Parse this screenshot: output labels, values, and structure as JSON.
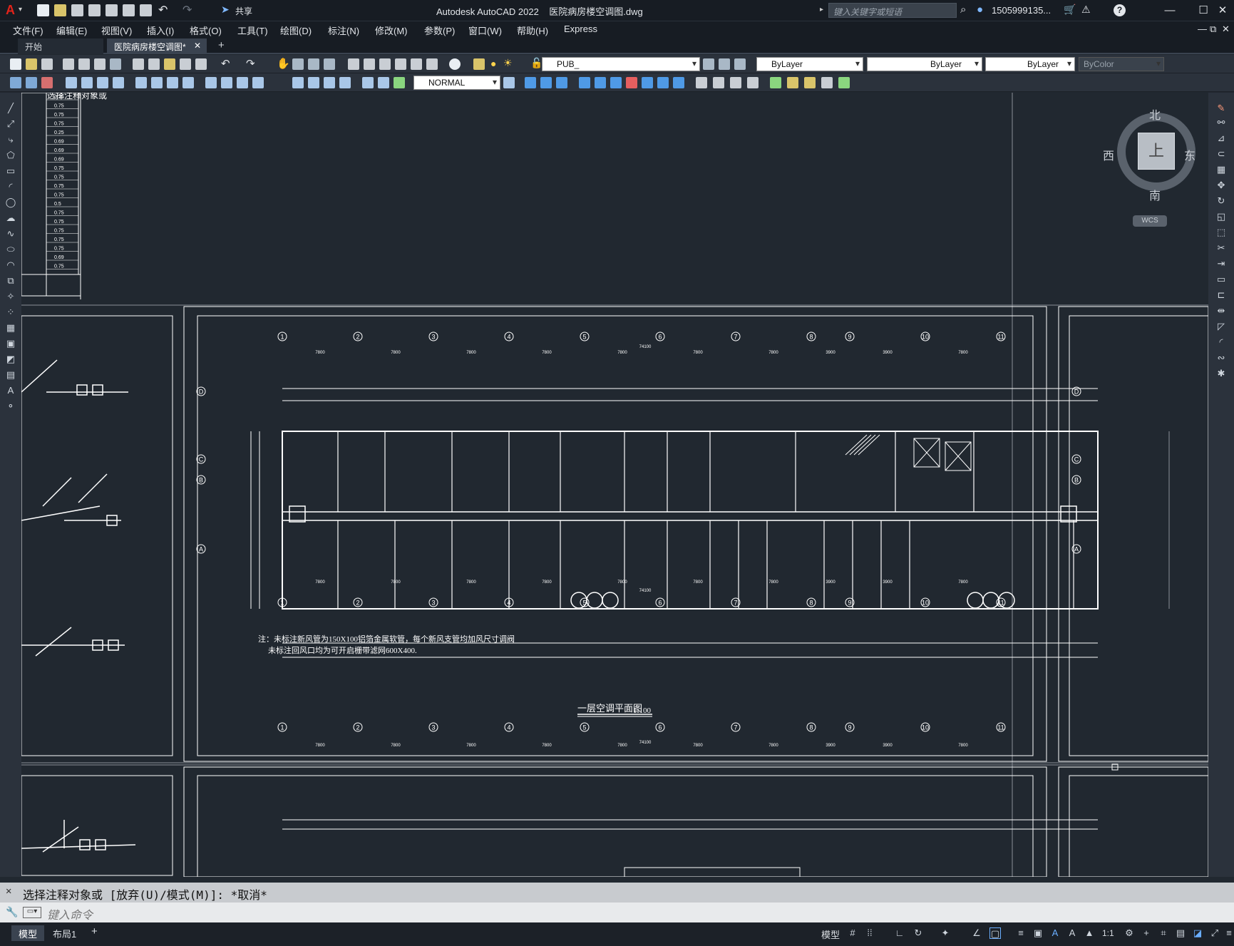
{
  "app": {
    "logo": "A",
    "share": "共享",
    "title": "Autodesk AutoCAD 2022",
    "filename": "医院病房楼空调图.dwg",
    "search_placeholder": "键入关键字或短语",
    "user": "1505999135...",
    "help": "?"
  },
  "menu": [
    "文件(F)",
    "编辑(E)",
    "视图(V)",
    "插入(I)",
    "格式(O)",
    "工具(T)",
    "绘图(D)",
    "标注(N)",
    "修改(M)",
    "参数(P)",
    "窗口(W)",
    "帮助(H)",
    "Express"
  ],
  "tabs": {
    "start": "开始",
    "doc": "医院病房楼空调图*",
    "close": "✕",
    "add": "+"
  },
  "toolbar": {
    "layer": "PUB_",
    "color": "ByLayer",
    "linetype": "ByLayer",
    "lineweight": "ByLayer",
    "plotstyle": "ByColor",
    "textstyle": "NORMAL"
  },
  "viewcube": {
    "north": "北",
    "south": "南",
    "east": "东",
    "west": "西",
    "top": "上",
    "wcs": "WCS"
  },
  "drawing": {
    "table_values": [
      "0.25",
      "0.75",
      "0.75",
      "0.75",
      "0.25",
      "0.69",
      "0.69",
      "0.69",
      "0.75",
      "0.75",
      "0.75",
      "0.75",
      "0.5",
      "0.75",
      "0.75",
      "0.75",
      "0.75",
      "0.75",
      "0.69",
      "0.75"
    ],
    "grid_top": [
      "1",
      "2",
      "3",
      "4",
      "5",
      "6",
      "7",
      "8",
      "9",
      "10",
      "11"
    ],
    "grid_side": [
      "D",
      "C",
      "B",
      "A"
    ],
    "dims": [
      "7800",
      "7800",
      "7800",
      "7800",
      "7800",
      "7800",
      "7800",
      "3900",
      "3900",
      "7800",
      "7800"
    ],
    "total_dim": "74100",
    "note_line1": "注：未标注新风管为150X100铝箔金属软管，每个新风支管均加风尺寸调阀",
    "note_line2": "未标注回风口均为可开启栅带滤网600X400.",
    "plan_title": "一层空调平面图",
    "plan_scale": "1:100",
    "cmd_overlay": "选择注释对象或"
  },
  "command": {
    "history": "选择注释对象或 [放弃(U)/模式(M)]: *取消*",
    "placeholder": "键入命令"
  },
  "status": {
    "model_tab": "模型",
    "layout_tab": "布局1",
    "add": "+",
    "model": "模型",
    "scale": "1:1"
  }
}
